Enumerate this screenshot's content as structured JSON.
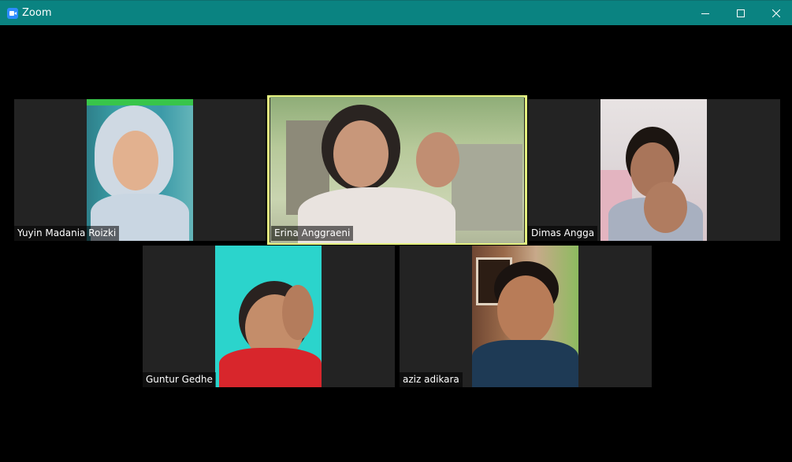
{
  "window": {
    "title": "Zoom",
    "icon": "zoom-video-icon",
    "controls": [
      "minimize-icon",
      "maximize-icon",
      "close-icon"
    ]
  },
  "participants": [
    {
      "name": "Yuyin Madania Roizki",
      "active_speaker": false
    },
    {
      "name": "Erina Anggraeni",
      "active_speaker": true
    },
    {
      "name": "Dimas Angga",
      "active_speaker": false
    },
    {
      "name": "Guntur Gedhe",
      "active_speaker": false
    },
    {
      "name": "aziz adikara",
      "active_speaker": false
    }
  ],
  "colors": {
    "titlebar": "#0a8381",
    "active_speaker_border": "#e4f080",
    "tile_background": "#232323"
  }
}
